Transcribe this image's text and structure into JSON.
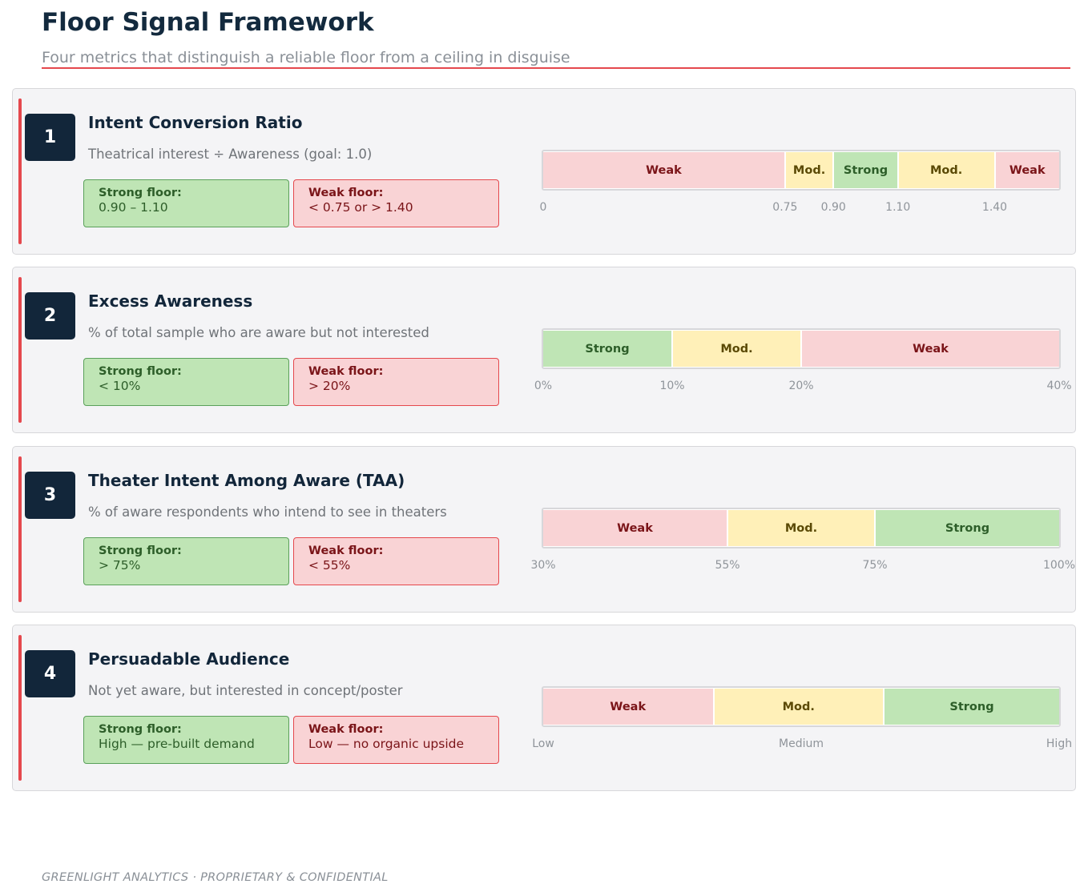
{
  "header": {
    "title": "Floor Signal Framework",
    "subtitle": "Four metrics that distinguish a reliable floor from a ceiling in disguise"
  },
  "colors": {
    "accent": "#e5484d",
    "navy": "#12263a",
    "weak_fill": "#f9d3d5",
    "moderate_fill": "#fff0b8",
    "strong_fill": "#bfe5b5"
  },
  "metrics": [
    {
      "number": "1",
      "title": "Intent Conversion Ratio",
      "description": "Theatrical interest ÷ Awareness  (goal: 1.0)",
      "strong_floor": {
        "label": "Strong floor:",
        "value": "0.90 – 1.10"
      },
      "weak_floor": {
        "label": "Weak floor:",
        "value": "< 0.75  or  > 1.40"
      },
      "scale": {
        "min": 0,
        "max": 1.6,
        "bands": [
          {
            "label": "Weak",
            "level": "weak",
            "from": 0,
            "to": 0.75
          },
          {
            "label": "Mod.",
            "level": "moderate",
            "from": 0.75,
            "to": 0.9
          },
          {
            "label": "Strong",
            "level": "strong",
            "from": 0.9,
            "to": 1.1
          },
          {
            "label": "Mod.",
            "level": "moderate",
            "from": 1.1,
            "to": 1.4
          },
          {
            "label": "Weak",
            "level": "weak",
            "from": 1.4,
            "to": 1.6
          }
        ],
        "ticks": [
          {
            "label": "0",
            "value": 0
          },
          {
            "label": "0.75",
            "value": 0.75
          },
          {
            "label": "0.90",
            "value": 0.9
          },
          {
            "label": "1.10",
            "value": 1.1
          },
          {
            "label": "1.40",
            "value": 1.4
          }
        ]
      }
    },
    {
      "number": "2",
      "title": "Excess Awareness",
      "description": "% of total sample who are aware but not interested",
      "strong_floor": {
        "label": "Strong floor:",
        "value": "< 10%"
      },
      "weak_floor": {
        "label": "Weak floor:",
        "value": "> 20%"
      },
      "scale": {
        "min": 0,
        "max": 40,
        "bands": [
          {
            "label": "Strong",
            "level": "strong",
            "from": 0,
            "to": 10
          },
          {
            "label": "Mod.",
            "level": "moderate",
            "from": 10,
            "to": 20
          },
          {
            "label": "Weak",
            "level": "weak",
            "from": 20,
            "to": 40
          }
        ],
        "ticks": [
          {
            "label": "0%",
            "value": 0
          },
          {
            "label": "10%",
            "value": 10
          },
          {
            "label": "20%",
            "value": 20
          },
          {
            "label": "40%",
            "value": 40
          }
        ]
      }
    },
    {
      "number": "3",
      "title": "Theater Intent Among Aware (TAA)",
      "description": "% of aware respondents who intend to see in theaters",
      "strong_floor": {
        "label": "Strong floor:",
        "value": "> 75%"
      },
      "weak_floor": {
        "label": "Weak floor:",
        "value": "< 55%"
      },
      "scale": {
        "min": 30,
        "max": 100,
        "bands": [
          {
            "label": "Weak",
            "level": "weak",
            "from": 30,
            "to": 55
          },
          {
            "label": "Mod.",
            "level": "moderate",
            "from": 55,
            "to": 75
          },
          {
            "label": "Strong",
            "level": "strong",
            "from": 75,
            "to": 100
          }
        ],
        "ticks": [
          {
            "label": "30%",
            "value": 30
          },
          {
            "label": "55%",
            "value": 55
          },
          {
            "label": "75%",
            "value": 75
          },
          {
            "label": "100%",
            "value": 100
          }
        ]
      }
    },
    {
      "number": "4",
      "title": "Persuadable Audience",
      "description": "Not yet aware, but interested in concept/poster",
      "strong_floor": {
        "label": "Strong floor:",
        "value": "High — pre-built demand"
      },
      "weak_floor": {
        "label": "Weak floor:",
        "value": "Low — no organic upside"
      },
      "scale": {
        "min": 0,
        "max": 1,
        "bands": [
          {
            "label": "Weak",
            "level": "weak",
            "from": 0,
            "to": 0.33
          },
          {
            "label": "Mod.",
            "level": "moderate",
            "from": 0.33,
            "to": 0.66
          },
          {
            "label": "Strong",
            "level": "strong",
            "from": 0.66,
            "to": 1
          }
        ],
        "ticks": [
          {
            "label": "Low",
            "value": 0
          },
          {
            "label": "Medium",
            "value": 0.5
          },
          {
            "label": "High",
            "value": 1
          }
        ]
      }
    }
  ],
  "footer": "GREENLIGHT ANALYTICS  ·  PROPRIETARY & CONFIDENTIAL"
}
